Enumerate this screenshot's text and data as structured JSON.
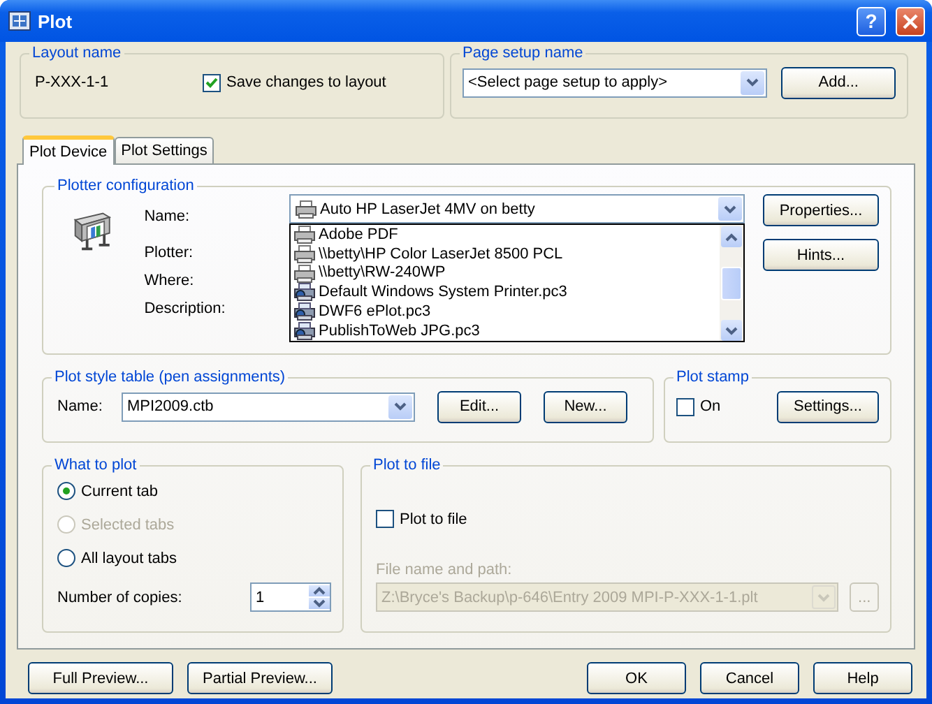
{
  "window": {
    "title": "Plot",
    "help": "?"
  },
  "layout_name": {
    "label": "Layout name",
    "value": "P-XXX-1-1",
    "save_changes": {
      "label": "Save changes to layout",
      "checked": true
    }
  },
  "page_setup": {
    "label": "Page setup name",
    "value": "<Select page setup to apply>",
    "button": "Add..."
  },
  "tabs": [
    {
      "label": "Plot Device",
      "selected": true
    },
    {
      "label": "Plot Settings",
      "selected": false
    }
  ],
  "plotter_config": {
    "label": "Plotter configuration",
    "fields": [
      "Name:",
      "Plotter:",
      "Where:",
      "Description:"
    ],
    "name_value": "Auto HP LaserJet 4MV on betty",
    "dropdown": [
      {
        "label": "Adobe PDF",
        "kind": "printer"
      },
      {
        "label": "\\\\betty\\HP Color LaserJet 8500 PCL",
        "kind": "printer"
      },
      {
        "label": "\\\\betty\\RW-240WP",
        "kind": "printer"
      },
      {
        "label": "Default Windows System Printer.pc3",
        "kind": "config"
      },
      {
        "label": "DWF6 ePlot.pc3",
        "kind": "config"
      },
      {
        "label": "PublishToWeb JPG.pc3",
        "kind": "config"
      }
    ],
    "buttons": [
      "Properties...",
      "Hints..."
    ]
  },
  "plot_style": {
    "label": "Plot style table (pen assignments)",
    "name_label": "Name:",
    "value": "MPI2009.ctb",
    "buttons": [
      "Edit...",
      "New..."
    ]
  },
  "plot_stamp": {
    "label": "Plot stamp",
    "on": {
      "label": "On",
      "checked": false
    },
    "button": "Settings..."
  },
  "what_to_plot": {
    "label": "What to plot",
    "options": [
      {
        "label": "Current tab",
        "selected": true,
        "disabled": false
      },
      {
        "label": "Selected tabs",
        "selected": false,
        "disabled": true
      },
      {
        "label": "All layout tabs",
        "selected": false,
        "disabled": false
      }
    ],
    "copies_label": "Number of copies:",
    "copies": "1"
  },
  "plot_to_file": {
    "label": "Plot to file",
    "checkbox": {
      "label": "Plot to file",
      "checked": false
    },
    "path_label": "File name and path:",
    "path": "Z:\\Bryce's Backup\\p-646\\Entry 2009 MPI-P-XXX-1-1.plt",
    "disabled": true,
    "browse": "..."
  },
  "footer": {
    "left": [
      "Full Preview...",
      "Partial Preview..."
    ],
    "right": [
      "OK",
      "Cancel",
      "Help"
    ]
  }
}
